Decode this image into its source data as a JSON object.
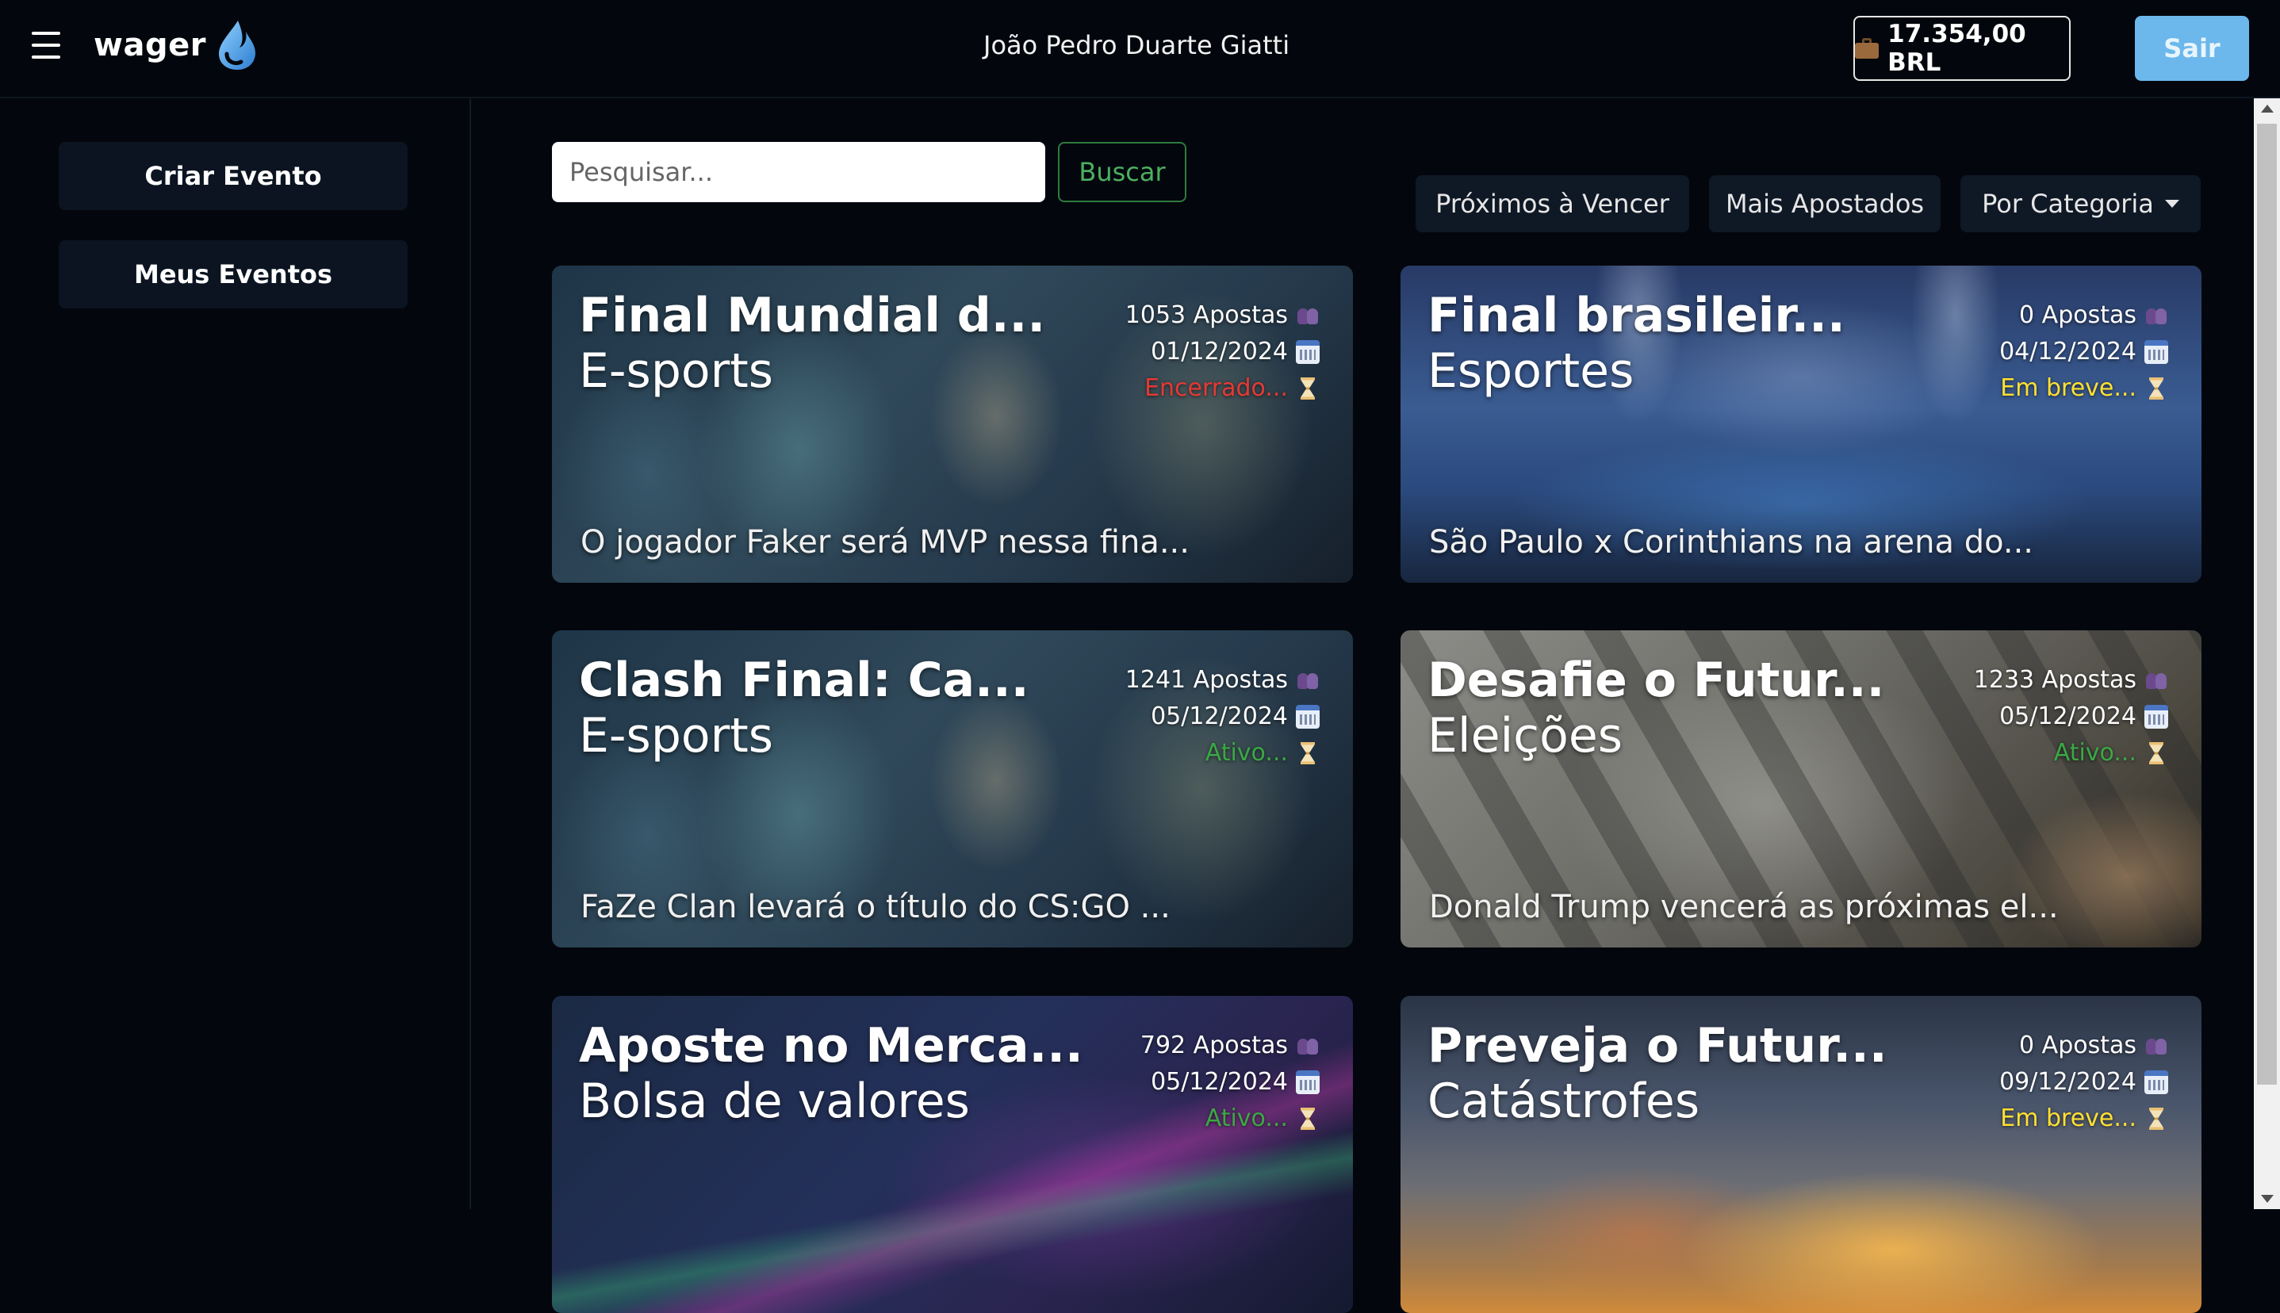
{
  "header": {
    "logo_text": "wager",
    "user_name": "João Pedro Duarte Giatti",
    "balance": "17.354,00 BRL",
    "logout_label": "Sair"
  },
  "sidebar": {
    "items": [
      {
        "label": "Criar Evento"
      },
      {
        "label": "Meus Eventos"
      }
    ]
  },
  "search": {
    "placeholder": "Pesquisar...",
    "button_label": "Buscar"
  },
  "filters": [
    {
      "label": "Próximos à Vencer"
    },
    {
      "label": "Mais Apostados"
    },
    {
      "label": "Por Categoria"
    }
  ],
  "colors": {
    "status_closed": "#e53935",
    "status_soon": "#ffe033",
    "status_active": "#3aa845",
    "accent": "#6cb8ec"
  },
  "cards": [
    {
      "title": "Final Mundial d...",
      "category": "E-sports",
      "bets": "1053 Apostas",
      "date": "01/12/2024",
      "status": "Encerrado...",
      "status_type": "closed",
      "description": "O jogador Faker será MVP nessa fina..."
    },
    {
      "title": "Final brasileir...",
      "category": "Esportes",
      "bets": "0 Apostas",
      "date": "04/12/2024",
      "status": "Em breve...",
      "status_type": "soon",
      "description": "São Paulo x Corinthians na arena do..."
    },
    {
      "title": "Clash Final: Ca...",
      "category": "E-sports",
      "bets": "1241 Apostas",
      "date": "05/12/2024",
      "status": "Ativo...",
      "status_type": "active",
      "description": "FaZe Clan levará o título do CS:GO ..."
    },
    {
      "title": "Desafie o Futur...",
      "category": "Eleições",
      "bets": "1233 Apostas",
      "date": "05/12/2024",
      "status": "Ativo...",
      "status_type": "active",
      "description": "Donald Trump vencerá as próximas el..."
    },
    {
      "title": "Aposte no Merca...",
      "category": "Bolsa de valores",
      "bets": "792 Apostas",
      "date": "05/12/2024",
      "status": "Ativo...",
      "status_type": "active",
      "description": ""
    },
    {
      "title": "Preveja o Futur...",
      "category": "Catástrofes",
      "bets": "0 Apostas",
      "date": "09/12/2024",
      "status": "Em breve...",
      "status_type": "soon",
      "description": ""
    }
  ]
}
